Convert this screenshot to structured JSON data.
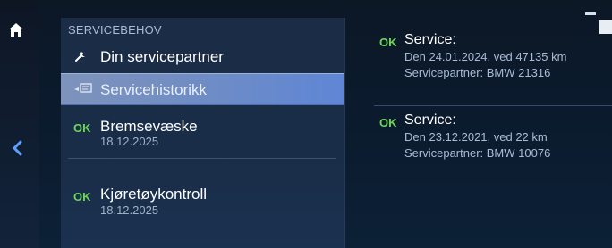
{
  "menu": {
    "title": "SERVICEBEHOV",
    "items": [
      {
        "label": "Din servicepartner",
        "icon": "wrench-icon"
      },
      {
        "label": "Servicehistorikk",
        "icon": "service-history-icon"
      },
      {
        "status": "OK",
        "label": "Bremsevæske",
        "date": "18.12.2025"
      },
      {
        "status": "OK",
        "label": "Kjøretøykontroll",
        "date": "18.12.2025"
      }
    ]
  },
  "details": {
    "entries": [
      {
        "status": "OK",
        "title": "Service:",
        "line1": "Den 24.01.2024, ved 47135 km",
        "line2": "Servicepartner: BMW 21316"
      },
      {
        "status": "OK",
        "title": "Service:",
        "line1": "Den 23.12.2021, ved 22 km",
        "line2": "Servicepartner: BMW 10076"
      }
    ]
  },
  "colors": {
    "ok_green": "#6ed65a",
    "highlight": "#6f8cc4",
    "panel": "#1a2d48"
  }
}
